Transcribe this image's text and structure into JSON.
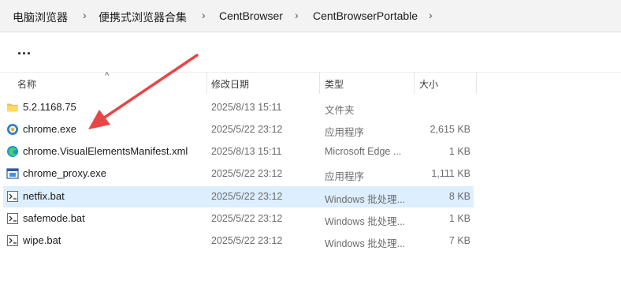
{
  "breadcrumb": [
    "电脑浏览器",
    "便携式浏览器合集",
    "CentBrowser",
    "CentBrowserPortable"
  ],
  "toolbar": {
    "more_label": "..."
  },
  "columns": {
    "name": "名称",
    "date": "修改日期",
    "type": "类型",
    "size": "大小"
  },
  "rows": [
    {
      "name": "5.2.1168.75",
      "date": "2025/8/13 15:11",
      "type": "文件夹",
      "size": "",
      "icon": "folder-icon"
    },
    {
      "name": "chrome.exe",
      "date": "2025/5/22 23:12",
      "type": "应用程序",
      "size": "2,615 KB",
      "icon": "centbrowser-icon"
    },
    {
      "name": "chrome.VisualElementsManifest.xml",
      "date": "2025/8/13 15:11",
      "type": "Microsoft Edge ...",
      "size": "1 KB",
      "icon": "edge-icon"
    },
    {
      "name": "chrome_proxy.exe",
      "date": "2025/5/22 23:12",
      "type": "应用程序",
      "size": "1,111 KB",
      "icon": "app-window-icon"
    },
    {
      "name": "netfix.bat",
      "date": "2025/5/22 23:12",
      "type": "Windows 批处理...",
      "size": "8 KB",
      "icon": "batch-file-icon"
    },
    {
      "name": "safemode.bat",
      "date": "2025/5/22 23:12",
      "type": "Windows 批处理...",
      "size": "1 KB",
      "icon": "batch-file-icon"
    },
    {
      "name": "wipe.bat",
      "date": "2025/5/22 23:12",
      "type": "Windows 批处理...",
      "size": "7 KB",
      "icon": "batch-file-icon"
    }
  ],
  "colors": {
    "selected_row": "#ddeefe",
    "annotation_arrow": "#e84646",
    "folder": "#f6c23e"
  }
}
